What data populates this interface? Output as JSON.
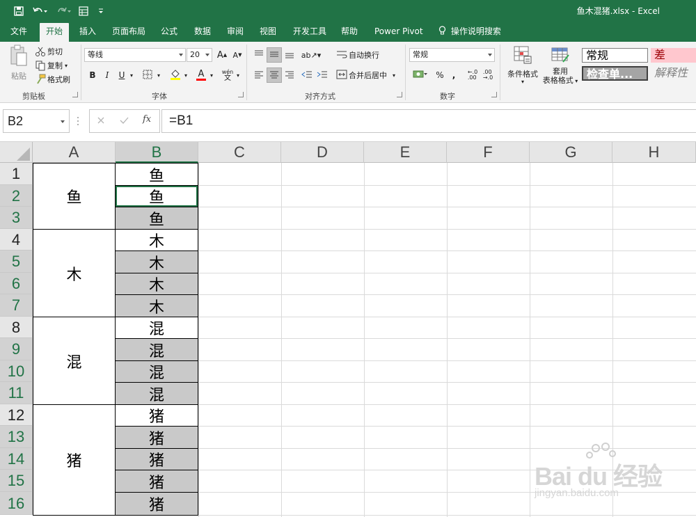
{
  "title_bar": {
    "file_title": "鱼木混猪.xlsx",
    "app_name": "Excel",
    "title_separator": " - "
  },
  "ribbon_tabs": [
    "文件",
    "开始",
    "插入",
    "页面布局",
    "公式",
    "数据",
    "审阅",
    "视图",
    "开发工具",
    "帮助",
    "Power Pivot",
    "操作说明搜索"
  ],
  "active_tab": "开始",
  "clipboard": {
    "paste": "粘贴",
    "cut": "剪切",
    "copy": "复制",
    "format_painter": "格式刷",
    "label": "剪贴板"
  },
  "font": {
    "family": "等线",
    "size": "20",
    "label": "字体",
    "bold": "B",
    "italic": "I",
    "underline": "U",
    "grow": "A",
    "shrink": "A",
    "font_color": "A",
    "phonetic": "wén"
  },
  "alignment": {
    "wrap_text": "自动换行",
    "merge_center": "合并后居中",
    "label": "对齐方式"
  },
  "number": {
    "format": "常规",
    "percent": "%",
    "comma": ",",
    "label": "数字"
  },
  "styles": {
    "conditional_formatting": "条件格式",
    "format_as_table_line1": "套用",
    "format_as_table_line2": "表格格式",
    "normal": "常规",
    "bad": "差",
    "check_cell": "检查单...",
    "explanatory": "解释性"
  },
  "formula_bar": {
    "name_box": "B2",
    "formula": "=B1",
    "fx": "fx"
  },
  "columns": [
    "A",
    "B",
    "C",
    "D",
    "E",
    "F",
    "G",
    "H"
  ],
  "selected_column": "B",
  "rows": [
    "1",
    "2",
    "3",
    "4",
    "5",
    "6",
    "7",
    "8",
    "9",
    "10",
    "11",
    "12",
    "13",
    "14",
    "15",
    "16"
  ],
  "selected_rows": [
    "2",
    "3",
    "5",
    "6",
    "7",
    "9",
    "10",
    "11",
    "13",
    "14",
    "15",
    "16"
  ],
  "merged_a": [
    {
      "text": "鱼",
      "rows": "1-3"
    },
    {
      "text": "木",
      "rows": "4-7"
    },
    {
      "text": "混",
      "rows": "8-11"
    },
    {
      "text": "猪",
      "rows": "12-16"
    }
  ],
  "column_b": [
    "鱼",
    "鱼",
    "鱼",
    "木",
    "木",
    "木",
    "木",
    "混",
    "混",
    "混",
    "混",
    "猪",
    "猪",
    "猪",
    "猪",
    "猪"
  ],
  "active_cell": "B2",
  "watermark": {
    "brand": "Bai du 经验",
    "url": "jingyan.baidu.com"
  },
  "colors": {
    "excel_green": "#217346",
    "selection_gray": "#c9c9c9",
    "header_gray": "#e6e6e6",
    "style_bad_bg": "#ffc7ce",
    "style_bad_text": "#9c0006"
  }
}
